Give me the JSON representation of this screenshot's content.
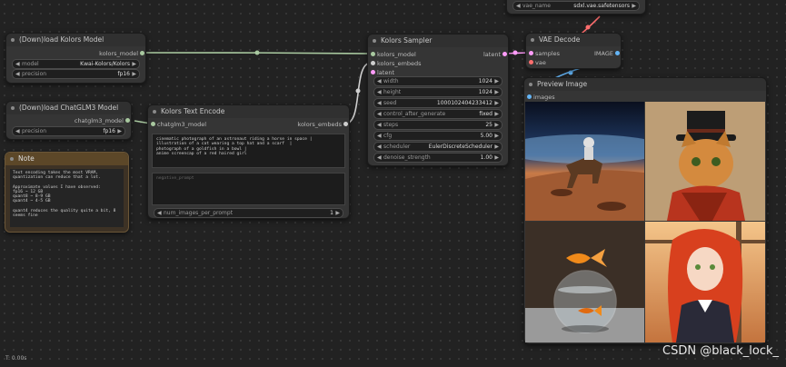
{
  "nodes": {
    "load_kolors": {
      "title": "(Down)load Kolors Model",
      "output_label": "kolors_model",
      "model_label": "model",
      "model_value": "Kwai-Kolors/Kolors",
      "precision_label": "precision",
      "precision_value": "fp16"
    },
    "load_chatglm": {
      "title": "(Down)load ChatGLM3 Model",
      "output_label": "chatglm3_model",
      "precision_label": "precision",
      "precision_value": "fp16"
    },
    "note": {
      "title": "Note",
      "text": "Text encoding takes the most VRAM,\nquantization can reduce that a lot.\n\nApproximate values I have observed:\nfp16 ~ 12 GB\nquant8 ~ 8-9 GB\nquant4 ~ 4-5 GB\n\nquant4 reduces the quality quite a bit, 8\nseems fine"
    },
    "text_encode": {
      "title": "Kolors Text Encode",
      "input_label": "chatglm3_model",
      "output_label": "kolors_embeds",
      "prompt": "cinematic photograph of an astronaut riding a horse in space |\nillustration of a cat wearing a top hat and a scarf  |\nphotograph of a goldfish in a bowl |\nanime screencap of a red haired girl",
      "negative_placeholder": "negative_prompt",
      "num_label": "num_images_per_prompt",
      "num_value": "1"
    },
    "sampler": {
      "title": "Kolors Sampler",
      "inputs": [
        "kolors_model",
        "kolors_embeds",
        "latent"
      ],
      "output_label": "latent",
      "widgets": [
        {
          "label": "width",
          "value": "1024"
        },
        {
          "label": "height",
          "value": "1024"
        },
        {
          "label": "seed",
          "value": "1000102404233412"
        },
        {
          "label": "control_after_generate",
          "value": "fixed"
        },
        {
          "label": "steps",
          "value": "25"
        },
        {
          "label": "cfg",
          "value": "5.00"
        },
        {
          "label": "scheduler",
          "value": "EulerDiscreteScheduler"
        },
        {
          "label": "denoise_strength",
          "value": "1.00"
        }
      ]
    },
    "vae_loader": {
      "label": "vae_name",
      "value": "sdxl.vae.safetensors"
    },
    "vae_decode": {
      "title": "VAE Decode",
      "inputs": [
        "samples",
        "vae"
      ],
      "output_label": "IMAGE"
    },
    "preview": {
      "title": "Preview Image",
      "input_label": "images",
      "images": [
        "astronaut-riding-horse",
        "cat-top-hat-scarf",
        "goldfish-in-bowl",
        "red-haired-anime-girl"
      ]
    }
  },
  "colors": {
    "model_link": "#a9c9a0",
    "embeds_link": "#cfcfcf",
    "latent_link": "#ff9cf9",
    "vae_link": "#ff6e6e",
    "image_link": "#64b5f6"
  },
  "status": "T: 0.00s",
  "watermark": "CSDN @black_lock_"
}
